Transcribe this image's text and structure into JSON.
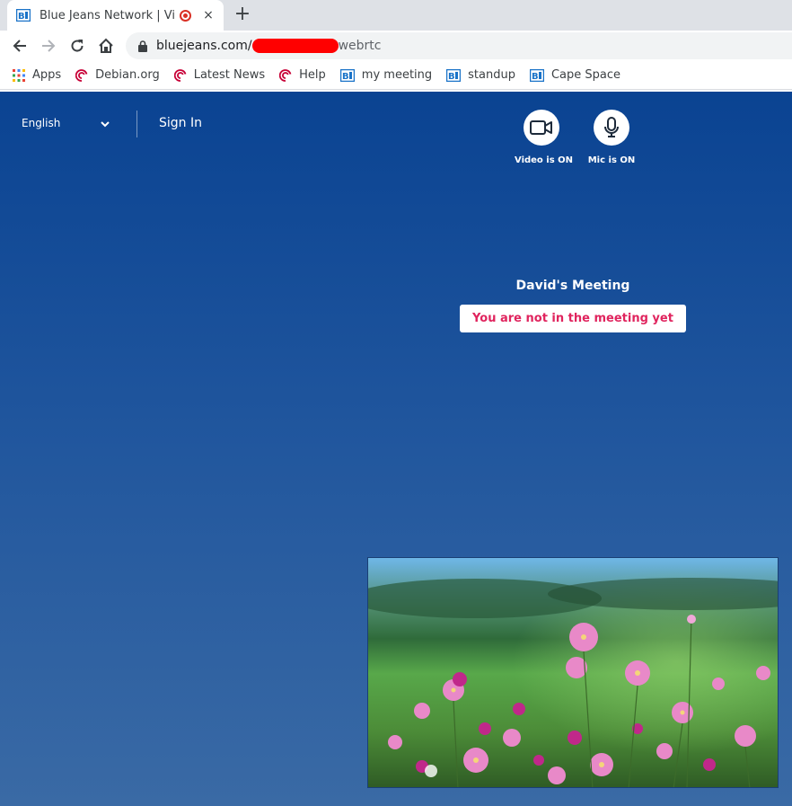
{
  "browser": {
    "tab_title": "Blue Jeans Network | Vi",
    "tab_close": "×",
    "new_tab": "+",
    "url_domain": "bluejeans.com/",
    "url_rest": "webrtc"
  },
  "bookmarks": [
    {
      "label": "Apps",
      "icon": "apps-grid-icon"
    },
    {
      "label": "Debian.org",
      "icon": "debian-swirl-icon"
    },
    {
      "label": "Latest News",
      "icon": "debian-swirl-icon"
    },
    {
      "label": "Help",
      "icon": "debian-swirl-icon"
    },
    {
      "label": "my meeting",
      "icon": "bluejeans-icon"
    },
    {
      "label": "standup",
      "icon": "bluejeans-icon"
    },
    {
      "label": "Cape Space",
      "icon": "bluejeans-icon"
    }
  ],
  "app": {
    "language": "English",
    "sign_in": "Sign In",
    "video_label": "Video is ON",
    "mic_label": "Mic is ON",
    "meeting_title": "David's Meeting",
    "status_text": "You are not in the meeting yet"
  },
  "colors": {
    "brand_blue": "#0a4392",
    "status_pink": "#e0245e",
    "redaction": "#ff0000"
  }
}
